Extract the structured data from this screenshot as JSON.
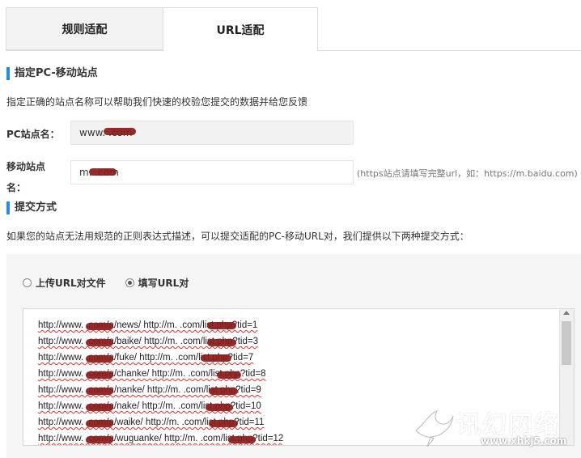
{
  "tabs": [
    {
      "label": "规则适配",
      "active": false
    },
    {
      "label": "URL适配",
      "active": true
    }
  ],
  "section1": {
    "title": "指定PC-移动站点",
    "description": "指定正确的站点名称可以帮助我们快速的校验您提交的数据并给您反馈"
  },
  "pc_site": {
    "label": "PC站点名：",
    "value": "www.       .com"
  },
  "mobile_site": {
    "label": "移动站点名：",
    "value": "m.        .com",
    "hint": "(https站点请填写完整url，如：https://m.baidu.com)"
  },
  "section2": {
    "title": "提交方式",
    "description": "如果您的站点无法用规范的正则表达式描述，可以提交适配的PC-移动URL对，我们提供以下两种提交方式："
  },
  "submit_options": [
    {
      "label": "上传URL对文件",
      "checked": false
    },
    {
      "label": "填写URL对",
      "checked": true
    }
  ],
  "url_pairs": [
    "http://www.        .com/a/news/ http://m.        .com/list.php?tid=1",
    "http://www.        .com/a/baike/ http://m.        .com/list.php?tid=3",
    "http://www.        .com/a/fuke/ http://m.        .com/list.php?tid=7",
    "http://www.        .com/a/chanke/ http://m.        .com/list.php?tid=8",
    "http://www.        .com/a/nanke/ http://m.        .com/list.php?tid=9",
    "http://www.        .com/a/nake/ http://m.        .com/list.php?tid=10",
    "http://www.        .com/a/waike/ http://m.        .com/list.php?tid=11",
    "http://www.        .com/a/wuguanke/ http://m.        .com/list.php?tid=12"
  ],
  "watermark": {
    "text": "讯幻网络",
    "url": "www.xhkj5.com"
  },
  "colors": {
    "accent": "#1f8ee8",
    "redaction": "#8b1a1a"
  }
}
